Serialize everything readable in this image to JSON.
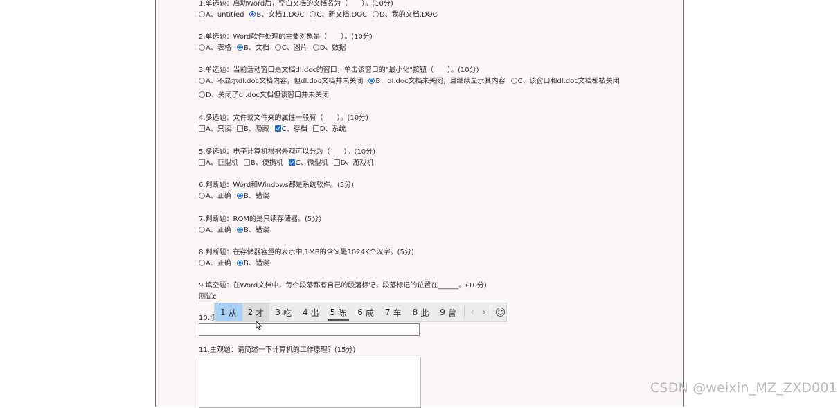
{
  "questions": [
    {
      "title": "1.单选题：启动Word后，空白文档的文档名为（　　）。(10分)",
      "type": "radio",
      "options": [
        {
          "label": "A、untitled",
          "checked": false
        },
        {
          "label": "B、文档1.DOC",
          "checked": true
        },
        {
          "label": "C、新文档.DOC",
          "checked": false
        },
        {
          "label": "D、我的文档.DOC",
          "checked": false
        }
      ]
    },
    {
      "title": "2.单选题：Word软件处理的主要对象是（　　）。(10分)",
      "type": "radio",
      "options": [
        {
          "label": "A、表格",
          "checked": false
        },
        {
          "label": "B、文档",
          "checked": true
        },
        {
          "label": "C、图片",
          "checked": false
        },
        {
          "label": "D、数据",
          "checked": false
        }
      ]
    },
    {
      "title": "3.单选题：当前活动窗口是文档dl.doc的窗口，单击该窗口的\"最小化\"按钮（　　）。(10分)",
      "type": "radio",
      "options": [
        {
          "label": "A、不显示dl.doc文档内容，但dl.doc文档并未关闭",
          "checked": false
        },
        {
          "label": "B、dl.doc文档未关闭，且继续显示其内容",
          "checked": true
        },
        {
          "label": "C、该窗口和dl.doc文档都被关闭",
          "checked": false
        },
        {
          "label": "D、关闭了dl.doc文档但该窗口并未关闭",
          "checked": false
        }
      ]
    },
    {
      "title": "4.多选题：文件或文件夹的属性一般有（　　）。(10分)",
      "type": "check",
      "options": [
        {
          "label": "A、只读",
          "checked": false
        },
        {
          "label": "B、隐藏",
          "checked": false
        },
        {
          "label": "C、存档",
          "checked": true
        },
        {
          "label": "D、系统",
          "checked": false
        }
      ]
    },
    {
      "title": "5.多选题：电子计算机根据外观可以分为（　　）。(10分)",
      "type": "check",
      "options": [
        {
          "label": "A、巨型机",
          "checked": false
        },
        {
          "label": "B、便携机",
          "checked": false
        },
        {
          "label": "C、微型机",
          "checked": true
        },
        {
          "label": "D、游戏机",
          "checked": false
        }
      ]
    },
    {
      "title": "6.判断题：Word和Windows都是系统软件。(5分)",
      "type": "radio",
      "options": [
        {
          "label": "A、正确",
          "checked": false
        },
        {
          "label": "B、错误",
          "checked": true
        }
      ]
    },
    {
      "title": "7.判断题：ROM的是只读存储器。(5分)",
      "type": "radio",
      "options": [
        {
          "label": "A、正确",
          "checked": false
        },
        {
          "label": "B、错误",
          "checked": true
        }
      ]
    },
    {
      "title": "8.判断题：在存储器容量的表示中,1MB的含义是1024K个汉字。(5分)",
      "type": "radio",
      "options": [
        {
          "label": "A、正确",
          "checked": false
        },
        {
          "label": "B、错误",
          "checked": true
        }
      ]
    }
  ],
  "q9": {
    "title": "9.填空题：在Word文档中，每个段落都有自己的段落标记，段落标记的位置在______。(10分)",
    "typed": "测试c"
  },
  "q10": {
    "title": "10.填"
  },
  "q11": {
    "title": "11.主观题：请简述一下计算机的工作原理？(15分)"
  },
  "ime": {
    "candidates": [
      {
        "n": "1",
        "ch": "从"
      },
      {
        "n": "2",
        "ch": "才"
      },
      {
        "n": "3",
        "ch": "吃"
      },
      {
        "n": "4",
        "ch": "出"
      },
      {
        "n": "5",
        "ch": "陈"
      },
      {
        "n": "6",
        "ch": "成"
      },
      {
        "n": "7",
        "ch": "车"
      },
      {
        "n": "8",
        "ch": "此"
      },
      {
        "n": "9",
        "ch": "曾"
      }
    ],
    "prev": "‹",
    "next": "›",
    "emoji": "☺"
  },
  "watermark": "CSDN @weixin_MZ_ZXD001",
  "colors": {
    "accent": "#1e6fd9",
    "page_bg": "#fbf7f8",
    "ime_selected": "#a9d0f5"
  }
}
